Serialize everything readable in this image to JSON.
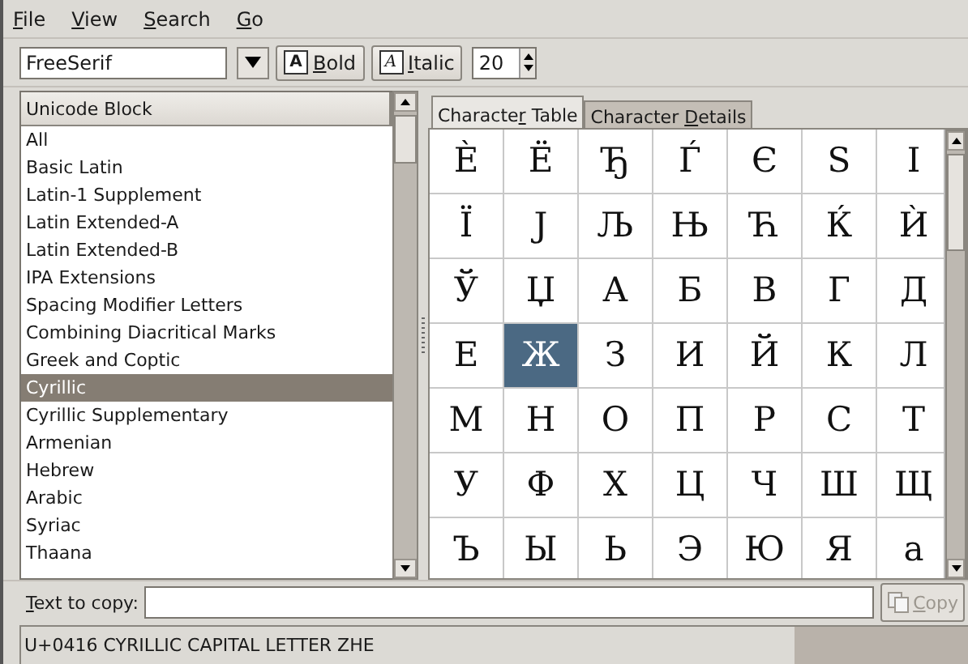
{
  "menu": [
    {
      "label": {
        "key": "F",
        "post": "ile"
      }
    },
    {
      "label": {
        "key": "V",
        "post": "iew"
      }
    },
    {
      "label": {
        "key": "S",
        "post": "earch"
      }
    },
    {
      "label": {
        "key": "G",
        "post": "o"
      }
    }
  ],
  "toolbar": {
    "font": "FreeSerif",
    "bold": {
      "icon": "A",
      "label": {
        "key": "B",
        "post": "old"
      }
    },
    "italic": {
      "icon": "A",
      "label": {
        "key": "I",
        "post": "talic"
      }
    },
    "size": "20"
  },
  "block_list": {
    "header": "Unicode Block",
    "items": [
      {
        "label": "All",
        "selected": false
      },
      {
        "label": "Basic Latin",
        "selected": false
      },
      {
        "label": "Latin-1 Supplement",
        "selected": false
      },
      {
        "label": "Latin Extended-A",
        "selected": false
      },
      {
        "label": "Latin Extended-B",
        "selected": false
      },
      {
        "label": "IPA Extensions",
        "selected": false
      },
      {
        "label": "Spacing Modifier Letters",
        "selected": false
      },
      {
        "label": "Combining Diacritical Marks",
        "selected": false
      },
      {
        "label": "Greek and Coptic",
        "selected": false
      },
      {
        "label": "Cyrillic",
        "selected": true
      },
      {
        "label": "Cyrillic Supplementary",
        "selected": false
      },
      {
        "label": "Armenian",
        "selected": false
      },
      {
        "label": "Hebrew",
        "selected": false
      },
      {
        "label": "Arabic",
        "selected": false
      },
      {
        "label": "Syriac",
        "selected": false
      },
      {
        "label": "Thaana",
        "selected": false
      }
    ]
  },
  "tabs": [
    {
      "label": {
        "pre": "Characte",
        "key": "r",
        "post": " Table"
      },
      "selected": true
    },
    {
      "label": {
        "pre": "Character ",
        "key": "D",
        "post": "etails"
      },
      "selected": false
    }
  ],
  "grid": {
    "rows": [
      {
        "cells": [
          {
            "char": "Ѐ",
            "selected": false
          },
          {
            "char": "Ё",
            "selected": false
          },
          {
            "char": "Ђ",
            "selected": false
          },
          {
            "char": "Ѓ",
            "selected": false
          },
          {
            "char": "Є",
            "selected": false
          },
          {
            "char": "Ѕ",
            "selected": false
          },
          {
            "char": "І",
            "selected": false
          }
        ]
      },
      {
        "cells": [
          {
            "char": "Ї",
            "selected": false
          },
          {
            "char": "Ј",
            "selected": false
          },
          {
            "char": "Љ",
            "selected": false
          },
          {
            "char": "Њ",
            "selected": false
          },
          {
            "char": "Ћ",
            "selected": false
          },
          {
            "char": "Ќ",
            "selected": false
          },
          {
            "char": "Ѝ",
            "selected": false
          }
        ]
      },
      {
        "cells": [
          {
            "char": "Ў",
            "selected": false
          },
          {
            "char": "Џ",
            "selected": false
          },
          {
            "char": "А",
            "selected": false
          },
          {
            "char": "Б",
            "selected": false
          },
          {
            "char": "В",
            "selected": false
          },
          {
            "char": "Г",
            "selected": false
          },
          {
            "char": "Д",
            "selected": false
          }
        ]
      },
      {
        "cells": [
          {
            "char": "Е",
            "selected": false
          },
          {
            "char": "Ж",
            "selected": true
          },
          {
            "char": "З",
            "selected": false
          },
          {
            "char": "И",
            "selected": false
          },
          {
            "char": "Й",
            "selected": false
          },
          {
            "char": "К",
            "selected": false
          },
          {
            "char": "Л",
            "selected": false
          }
        ]
      },
      {
        "cells": [
          {
            "char": "М",
            "selected": false
          },
          {
            "char": "Н",
            "selected": false
          },
          {
            "char": "О",
            "selected": false
          },
          {
            "char": "П",
            "selected": false
          },
          {
            "char": "Р",
            "selected": false
          },
          {
            "char": "С",
            "selected": false
          },
          {
            "char": "Т",
            "selected": false
          }
        ]
      },
      {
        "cells": [
          {
            "char": "У",
            "selected": false
          },
          {
            "char": "Ф",
            "selected": false
          },
          {
            "char": "Х",
            "selected": false
          },
          {
            "char": "Ц",
            "selected": false
          },
          {
            "char": "Ч",
            "selected": false
          },
          {
            "char": "Ш",
            "selected": false
          },
          {
            "char": "Щ",
            "selected": false
          }
        ]
      },
      {
        "cells": [
          {
            "char": "Ъ",
            "selected": false
          },
          {
            "char": "Ы",
            "selected": false
          },
          {
            "char": "Ь",
            "selected": false
          },
          {
            "char": "Э",
            "selected": false
          },
          {
            "char": "Ю",
            "selected": false
          },
          {
            "char": "Я",
            "selected": false
          },
          {
            "char": "а",
            "selected": false
          }
        ]
      }
    ]
  },
  "copy_row": {
    "label": {
      "key": "T",
      "post": "ext to copy:"
    },
    "button": {
      "label": {
        "key": "C",
        "post": "opy"
      },
      "disabled": true
    }
  },
  "status_bar": {
    "text": "U+0416 CYRILLIC CAPITAL LETTER ZHE"
  }
}
